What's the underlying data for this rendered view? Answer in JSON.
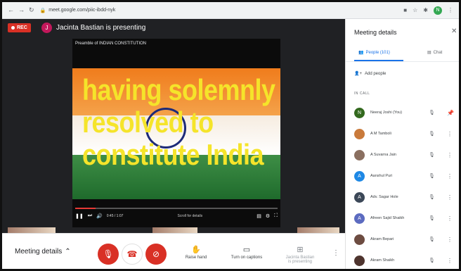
{
  "browser": {
    "url": "meet.google.com/piic-ibdd-nyk",
    "profile_initial": "N"
  },
  "call": {
    "rec_label": "REC",
    "presenter_initial": "J",
    "presenter_text": "Jacinta Bastian is presenting",
    "slide_title": "Preamble of INDIAN CONSTITUTION",
    "video_text": "having solemnly\nresolved to\nconstitute India",
    "video_time": "0:45 / 1:07",
    "video_hint": "Scroll for details",
    "video_progress": 0.1
  },
  "bottom": {
    "meeting_details_label": "Meeting details",
    "raise_hand_label": "Raise hand",
    "captions_label": "Turn on captions",
    "presenting_label_1": "Jacinta Bastian",
    "presenting_label_2": "is presenting"
  },
  "panel": {
    "title": "Meeting details",
    "people_tab": "People (101)",
    "chat_tab": "Chat",
    "add_people": "Add people",
    "in_call_label": "IN CALL",
    "participants": [
      {
        "name": "Neeraj Joshi (You)",
        "initial": "N",
        "color": "#33691e"
      },
      {
        "name": "A M Tamboli",
        "initial": "",
        "color": "#c97a3b"
      },
      {
        "name": "A Suvarna Jain",
        "initial": "",
        "color": "#8a6f60"
      },
      {
        "name": "Aanshul Puri",
        "initial": "A",
        "color": "#1e88e5"
      },
      {
        "name": "Adv. Sagar Hole",
        "initial": "A",
        "color": "#3c4858"
      },
      {
        "name": "Afreen Sajid Shaikh",
        "initial": "A",
        "color": "#5c6bc0"
      },
      {
        "name": "Akram Bepari",
        "initial": "",
        "color": "#6d4c41"
      },
      {
        "name": "Akram Shaikh",
        "initial": "",
        "color": "#4e342e"
      }
    ]
  }
}
